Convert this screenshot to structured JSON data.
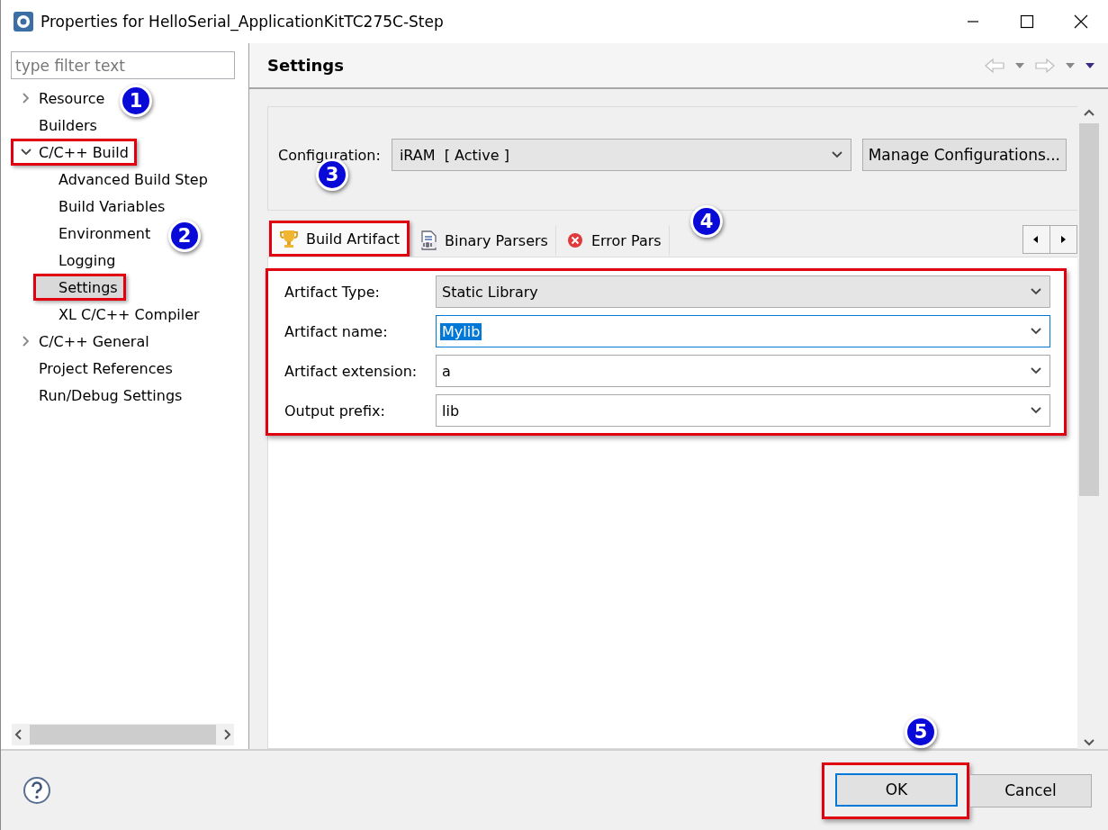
{
  "window": {
    "title": "Properties for HelloSerial_ApplicationKitTC275C-Step"
  },
  "filter": {
    "placeholder": "type filter text"
  },
  "tree": [
    {
      "label": "Resource",
      "expanded": false,
      "selected": false,
      "highlighted": false
    },
    {
      "label": "Builders",
      "selected": false,
      "highlighted": false
    },
    {
      "label": "C/C++ Build",
      "expanded": true,
      "selected": false,
      "highlighted": true,
      "children": [
        {
          "label": "Advanced Build Step",
          "selected": false,
          "highlighted": false
        },
        {
          "label": "Build Variables",
          "selected": false,
          "highlighted": false
        },
        {
          "label": "Environment",
          "selected": false,
          "highlighted": false
        },
        {
          "label": "Logging",
          "selected": false,
          "highlighted": false
        },
        {
          "label": "Settings",
          "selected": true,
          "highlighted": true
        },
        {
          "label": "XL C/C++ Compiler",
          "selected": false,
          "highlighted": false
        }
      ]
    },
    {
      "label": "C/C++ General",
      "expanded": false,
      "selected": false,
      "highlighted": false
    },
    {
      "label": "Project References",
      "selected": false,
      "highlighted": false
    },
    {
      "label": "Run/Debug Settings",
      "selected": false,
      "highlighted": false
    }
  ],
  "page": {
    "title": "Settings",
    "configuration": {
      "label": "Configuration:",
      "value": "iRAM  [ Active ]",
      "button": "Manage Configurations..."
    },
    "tabs": [
      {
        "label": "Build Artifact",
        "kind": "trophy",
        "selected": true,
        "highlighted": true
      },
      {
        "label": "Binary Parsers",
        "kind": "binary",
        "selected": false,
        "highlighted": false
      },
      {
        "label": "Error Pars",
        "kind": "error",
        "selected": false,
        "highlighted": false
      }
    ],
    "form": {
      "highlighted": true,
      "fields": [
        {
          "label": "Artifact Type:",
          "value": "Static Library",
          "kind": "readonly",
          "focused": false
        },
        {
          "label": "Artifact name:",
          "value": "Mylib",
          "kind": "editable",
          "focused": true
        },
        {
          "label": "Artifact extension:",
          "value": "a",
          "kind": "editable",
          "focused": false
        },
        {
          "label": "Output prefix:",
          "value": "lib",
          "kind": "editable",
          "focused": false
        }
      ]
    }
  },
  "buttons": [
    {
      "label": "OK",
      "default": true,
      "highlighted": true
    },
    {
      "label": "Cancel",
      "default": false,
      "highlighted": false
    }
  ],
  "annotations": [
    {
      "label": "1"
    },
    {
      "label": "2"
    },
    {
      "label": "3"
    },
    {
      "label": "4"
    },
    {
      "label": "5"
    }
  ]
}
